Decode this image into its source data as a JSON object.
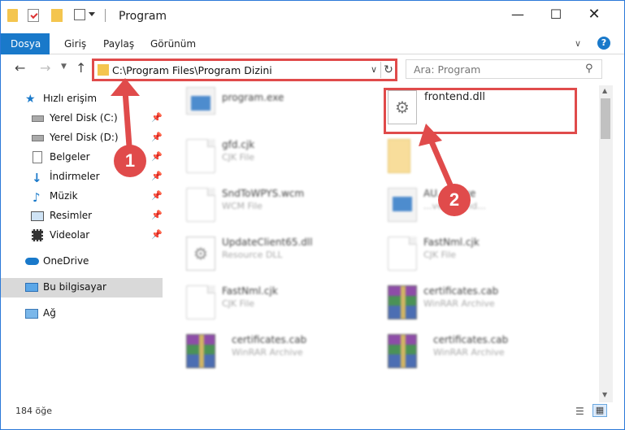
{
  "window": {
    "title": "Program"
  },
  "ribbon": {
    "tabs": [
      "Dosya",
      "Giriş",
      "Paylaş",
      "Görünüm"
    ]
  },
  "address": {
    "path": "C:\\Program Files\\Program Dizini"
  },
  "search": {
    "placeholder": "Ara: Program"
  },
  "sidebar": {
    "quick_access": "Hızlı erişim",
    "items": [
      {
        "label": "Yerel Disk (C:)",
        "icon": "drive-icon",
        "pinned": true
      },
      {
        "label": "Yerel Disk (D:)",
        "icon": "drive-icon",
        "pinned": true
      },
      {
        "label": "Belgeler",
        "icon": "documents-icon",
        "pinned": true
      },
      {
        "label": "İndirmeler",
        "icon": "download-icon",
        "pinned": true
      },
      {
        "label": "Müzik",
        "icon": "music-icon",
        "pinned": true
      },
      {
        "label": "Resimler",
        "icon": "pictures-icon",
        "pinned": true
      },
      {
        "label": "Videolar",
        "icon": "video-icon",
        "pinned": true
      }
    ],
    "onedrive": "OneDrive",
    "this_pc": "Bu bilgisayar",
    "network": "Ağ"
  },
  "files": [
    {
      "name": "program.exe",
      "type": "",
      "icon": "exe-icon"
    },
    {
      "name": "frontend.dll",
      "type": "",
      "icon": "gear-file-icon"
    },
    {
      "name": "gfd.cjk",
      "type": "CJK File",
      "icon": "file-icon"
    },
    {
      "name": "",
      "type": "",
      "icon": "folder-icon"
    },
    {
      "name": "SndToWPYS.wcm",
      "type": "WCM File",
      "icon": "file-icon"
    },
    {
      "name": "AU...TI.exe",
      "type": "...vent hand...",
      "icon": "exe-icon"
    },
    {
      "name": "UpdateClient65.dll",
      "type": "Resource DLL",
      "icon": "gear-file-icon"
    },
    {
      "name": "FastNml.cjk",
      "type": "CJK File",
      "icon": "file-icon"
    },
    {
      "name": "FastNml.cjk",
      "type": "CJK File",
      "icon": "file-icon"
    },
    {
      "name": "certificates.cab",
      "type": "WinRAR Archive",
      "icon": "rar-icon"
    },
    {
      "name": "certificates.cab",
      "type": "WinRAR Archive",
      "icon": "rar-icon"
    },
    {
      "name": "certificates.cab",
      "type": "WinRAR Archive",
      "icon": "rar-icon"
    }
  ],
  "status": {
    "item_count": "184 öğe"
  },
  "annotations": {
    "step1": "1",
    "step2": "2"
  },
  "colors": {
    "accent": "#1979ca",
    "annotation": "#e04b4b",
    "folder": "#f4c54e"
  }
}
